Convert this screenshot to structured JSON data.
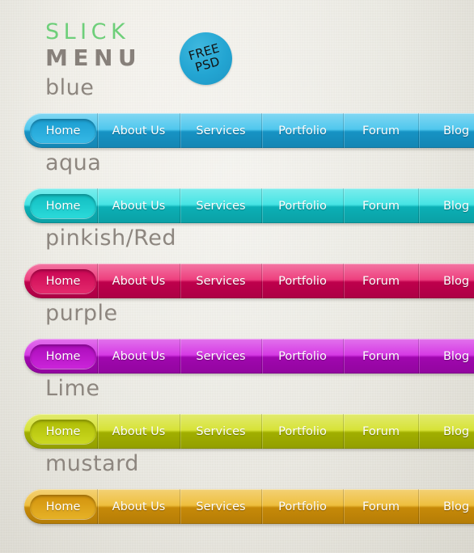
{
  "header": {
    "logo_line1": "SLICK",
    "logo_line2": "MENU",
    "logo_line1_color": "#6ecf7a",
    "logo_line2_color": "#87807a",
    "badge": {
      "line1": "FREE",
      "line2": "PSD",
      "color": "#23a5d2",
      "text_color": "#121212"
    }
  },
  "background_color": "#eceae3",
  "section_label_color": "#8d867f",
  "menu_items": [
    "Home",
    "About Us",
    "Services",
    "Portfolio",
    "Forum",
    "Blog"
  ],
  "active_item": "Home",
  "sections": [
    {
      "label": "blue",
      "theme": {
        "top": "#3fc2ec",
        "bottom": "#1799cd",
        "active_top": "#1a9dd0",
        "active_bottom": "#36b9e6",
        "accent": "#29ABD5"
      }
    },
    {
      "label": "aqua",
      "theme": {
        "top": "#35e2e2",
        "bottom": "#0cb7bd",
        "active_top": "#10bcc0",
        "active_bottom": "#2bdada",
        "accent": "#1FD4D4"
      }
    },
    {
      "label": "pinkish/Red",
      "theme": {
        "top": "#ec2d72",
        "bottom": "#c6004f",
        "active_top": "#c90553",
        "active_bottom": "#e52a6d",
        "accent": "#E8246B"
      }
    },
    {
      "label": "purple",
      "theme": {
        "top": "#d228e2",
        "bottom": "#a707b6",
        "active_top": "#ab0bb9",
        "active_bottom": "#cb25da",
        "accent": "#C31ACF"
      }
    },
    {
      "label": "Lime",
      "theme": {
        "top": "#d3e024",
        "bottom": "#a8b600",
        "active_top": "#adbb05",
        "active_bottom": "#cbd921",
        "accent": "#C5D31A"
      }
    },
    {
      "label": "mustard",
      "theme": {
        "top": "#edb92c",
        "bottom": "#cf8f08",
        "active_top": "#d2920c",
        "active_bottom": "#e6b227",
        "accent": "#DDA520"
      }
    }
  ],
  "layout": {
    "section_tops": [
      95,
      188,
      281,
      374,
      467,
      560
    ],
    "bar_tops": [
      140,
      233,
      326,
      419,
      512,
      605
    ],
    "item_widths": [
      90,
      102,
      101,
      101,
      93,
      93
    ]
  }
}
